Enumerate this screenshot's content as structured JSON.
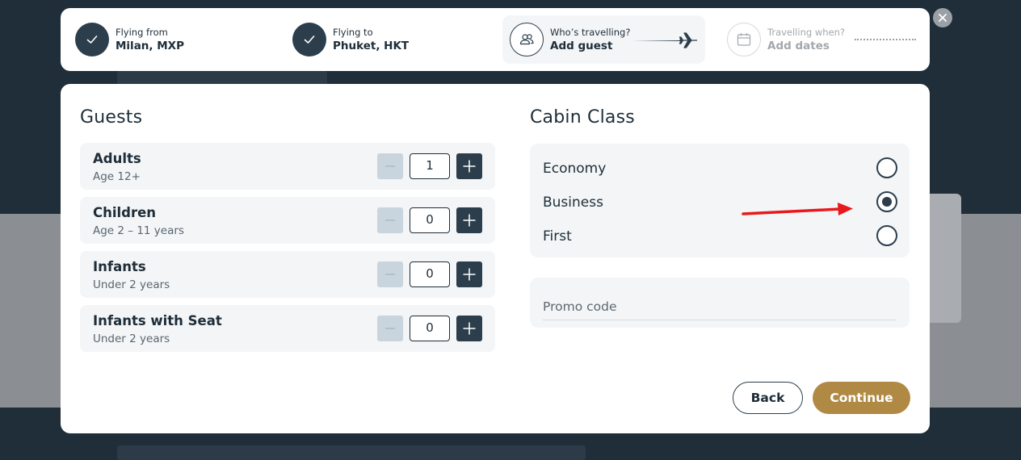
{
  "stepper": {
    "steps": [
      {
        "label": "Flying from",
        "value": "Milan, MXP",
        "icon": "check-icon",
        "state": "done"
      },
      {
        "label": "Flying to",
        "value": "Phuket, HKT",
        "icon": "check-icon",
        "state": "done"
      },
      {
        "label": "Who’s travelling?",
        "value": "Add guest",
        "icon": "guests-icon",
        "state": "current"
      },
      {
        "label": "Travelling when?",
        "value": "Add dates",
        "icon": "calendar-icon",
        "state": "future"
      }
    ],
    "close_icon": "close-icon"
  },
  "guests": {
    "title": "Guests",
    "rows": [
      {
        "name": "Adults",
        "sub": "Age 12+",
        "quantity": "1"
      },
      {
        "name": "Children",
        "sub": "Age 2 – 11 years",
        "quantity": "0"
      },
      {
        "name": "Infants",
        "sub": "Under 2 years",
        "quantity": "0"
      },
      {
        "name": "Infants with Seat",
        "sub": "Under 2 years",
        "quantity": "0"
      }
    ]
  },
  "cabin": {
    "title": "Cabin Class",
    "options": [
      {
        "label": "Economy",
        "selected": false
      },
      {
        "label": "Business",
        "selected": true
      },
      {
        "label": "First",
        "selected": false
      }
    ]
  },
  "promo": {
    "placeholder": "Promo code",
    "value": ""
  },
  "actions": {
    "back_label": "Back",
    "continue_label": "Continue"
  },
  "colors": {
    "primary": "#2c3e4c",
    "accent": "#b08a45",
    "annotation_arrow": "#e8191c",
    "panel_bg": "#f3f5f7",
    "backdrop": "#1f2e39"
  }
}
